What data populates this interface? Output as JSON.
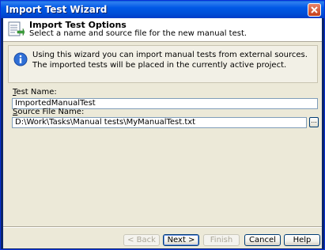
{
  "window": {
    "title": "Import Test Wizard"
  },
  "header": {
    "title": "Import Test Options",
    "subtitle": "Select a name and source file for the new manual test."
  },
  "info": {
    "text": "Using this wizard you can import manual tests from external sources. The imported tests will be placed in the currently active project."
  },
  "fields": {
    "test_name": {
      "label_accel": "T",
      "label_rest": "est Name:",
      "value": "ImportedManualTest"
    },
    "source_file": {
      "label_accel": "S",
      "label_rest": "ource File Name:",
      "value": "D:\\Work\\Tasks\\Manual tests\\MyManualTest.txt",
      "browse_label": "..."
    }
  },
  "buttons": {
    "back": "< Back",
    "next": "Next >",
    "finish": "Finish",
    "cancel": "Cancel",
    "help": "Help"
  },
  "icons": {
    "close": "close-icon",
    "header": "wizard-icon",
    "info": "info-icon"
  }
}
